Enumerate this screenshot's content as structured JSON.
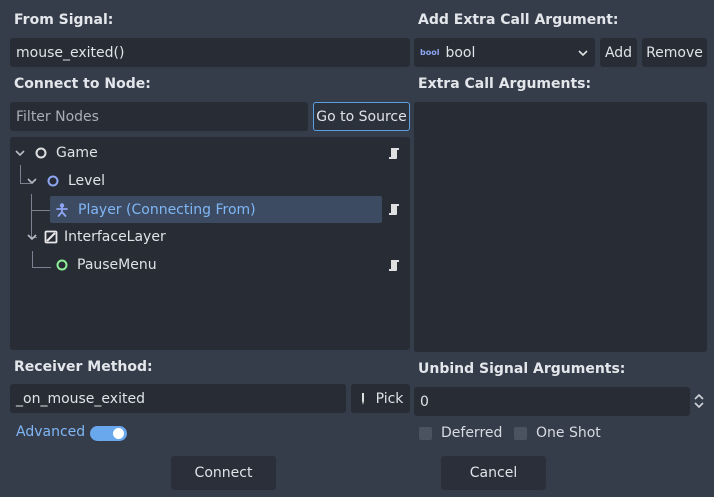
{
  "from_signal": {
    "label": "From Signal:",
    "value": "mouse_exited()"
  },
  "connect_to_node": {
    "label": "Connect to Node:",
    "filter_placeholder": "Filter Nodes",
    "go_to_source": "Go to Source",
    "tree": [
      {
        "name": "Game",
        "icon": "node-circle-icon"
      },
      {
        "name": "Level",
        "icon": "node2d-circle-icon"
      },
      {
        "name": "Player (Connecting From)",
        "icon": "character-body-icon",
        "selected": true
      },
      {
        "name": "InterfaceLayer",
        "icon": "canvas-layer-icon"
      },
      {
        "name": "PauseMenu",
        "icon": "control-circle-icon"
      }
    ]
  },
  "receiver_method": {
    "label": "Receiver Method:",
    "value": "_on_mouse_exited",
    "pick": "Pick"
  },
  "advanced": {
    "label": "Advanced",
    "enabled": true
  },
  "extra_args": {
    "label": "Add Extra Call Argument:",
    "type": "bool",
    "type_icon_text": "bool",
    "add": "Add",
    "remove": "Remove",
    "list_label": "Extra Call Arguments:"
  },
  "unbind": {
    "label": "Unbind Signal Arguments:",
    "value": "0"
  },
  "options": {
    "deferred": "Deferred",
    "one_shot": "One Shot"
  },
  "actions": {
    "connect": "Connect",
    "cancel": "Cancel"
  },
  "colors": {
    "background": "#363d4a",
    "field": "#272c35",
    "accent": "#5c9fe0",
    "selected_text": "#7fb6f5"
  }
}
